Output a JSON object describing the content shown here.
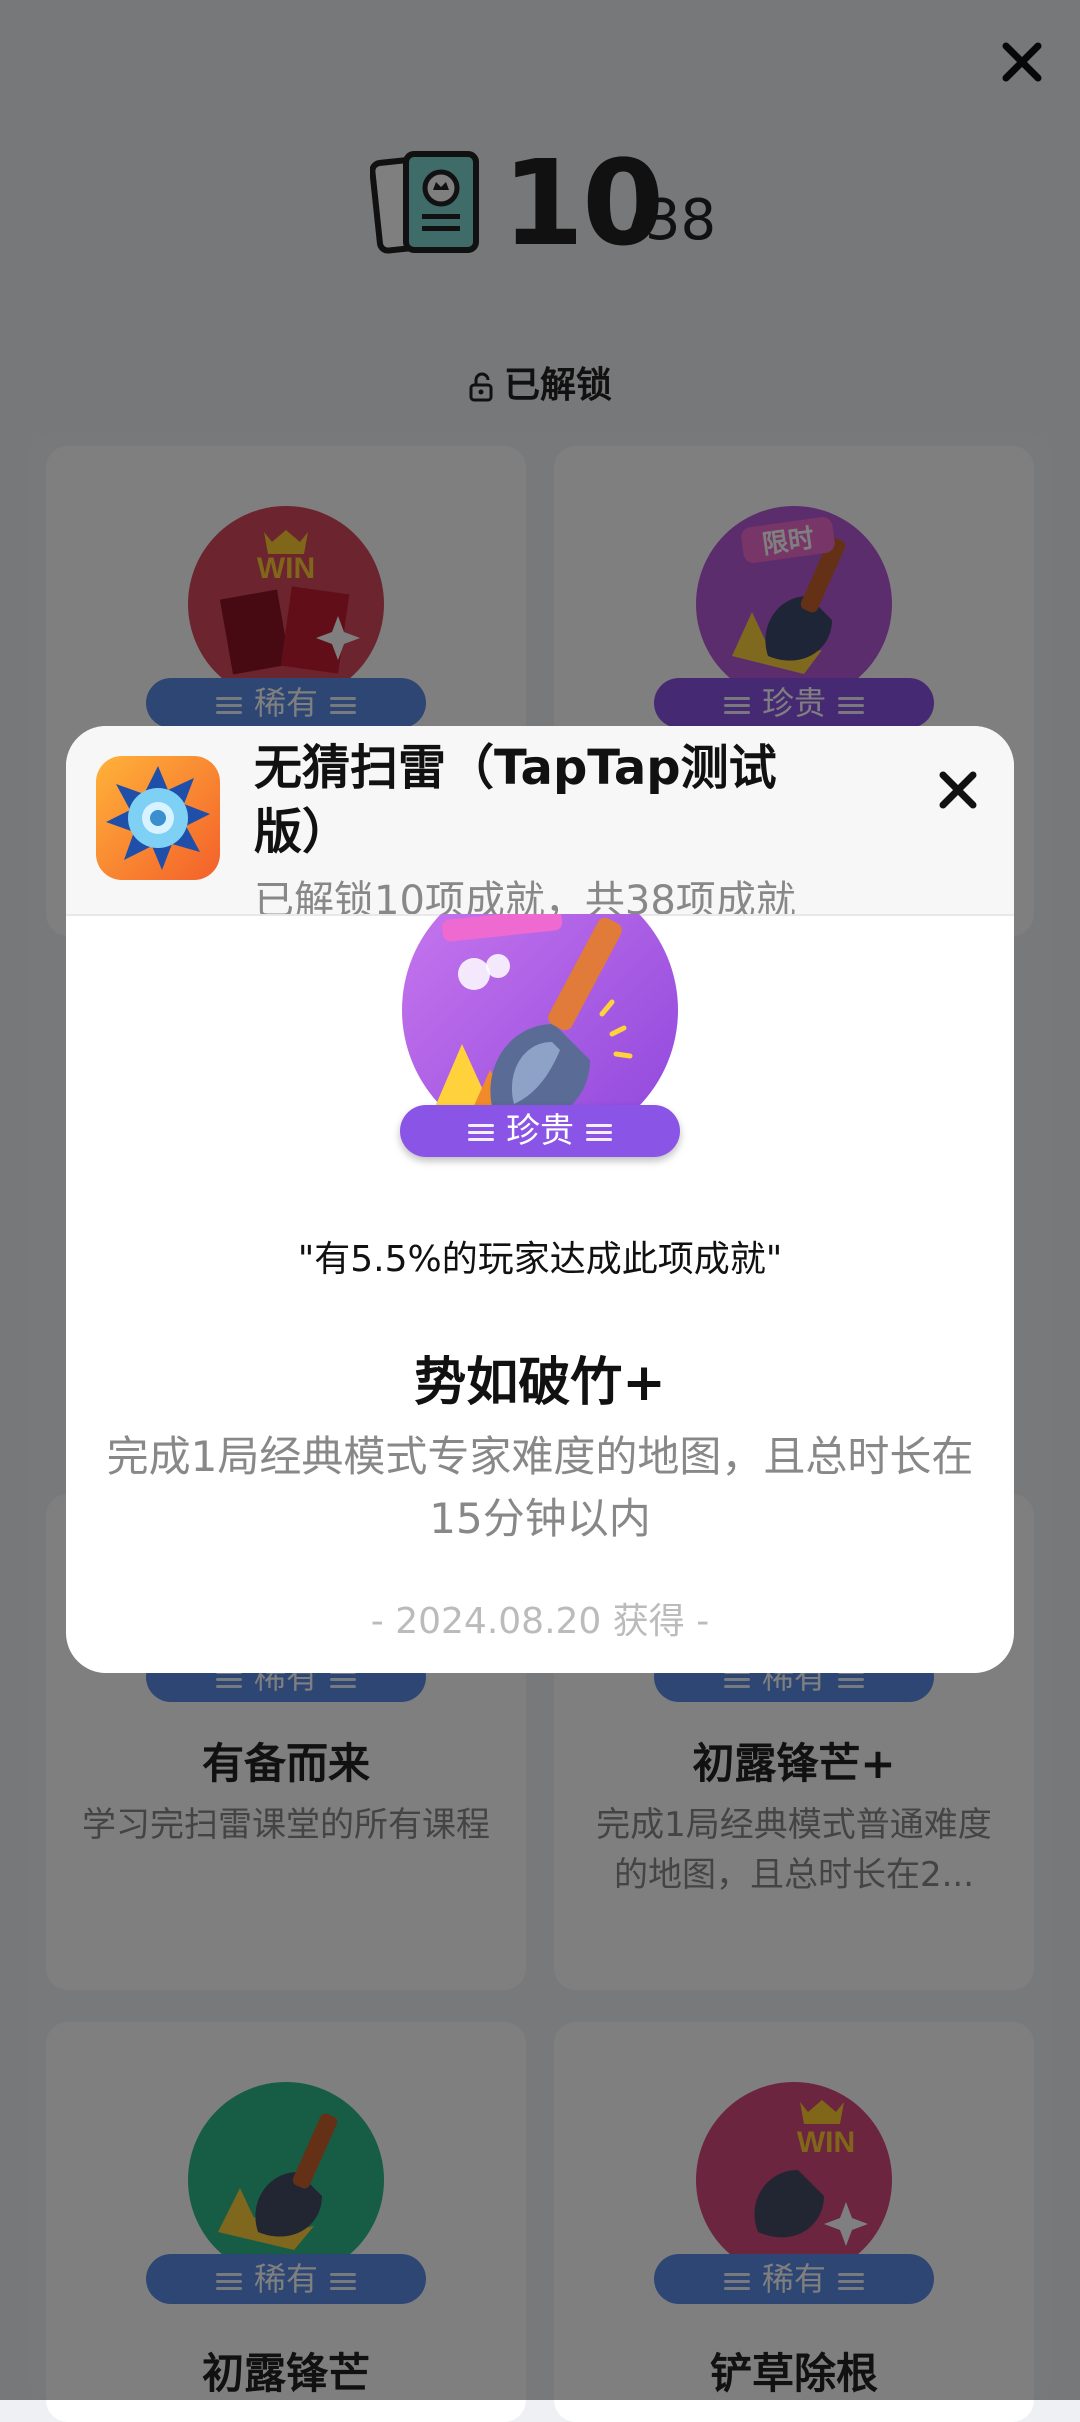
{
  "counter": {
    "unlocked": "10",
    "total": "/38"
  },
  "section_label": "已解锁",
  "cards": [
    {
      "badge": "稀有",
      "tier": "rare",
      "art_text": "WIN",
      "art": "win"
    },
    {
      "badge": "珍贵",
      "tier": "precious",
      "art_text": "限时",
      "art": "shovel-purple"
    },
    {
      "badge": "稀有",
      "tier": "rare",
      "title": "有备而来",
      "desc": "学习完扫雷课堂的所有课程"
    },
    {
      "badge": "稀有",
      "tier": "rare",
      "title": "初露锋芒+",
      "desc": "完成1局经典模式普通难度的地图，且总时长在2..."
    },
    {
      "badge": "稀有",
      "tier": "rare",
      "title": "初露锋芒",
      "art": "shovel-green"
    },
    {
      "badge": "稀有",
      "tier": "rare",
      "title": "铲草除根",
      "art_text": "WIN",
      "art": "win-shovel"
    }
  ],
  "modal": {
    "game_title": "无猜扫雷（TapTap测试版）",
    "game_subtitle": "已解锁10项成就，共38项成就",
    "badge": "珍贵",
    "quote": "\"有5.5%的玩家达成此项成就\"",
    "name": "势如破竹+",
    "description": "完成1局经典模式专家难度的地图，且总时长在15分钟以内",
    "date": "- 2024.08.20 获得 -"
  },
  "colors": {
    "rare": "#5a8ce8",
    "precious": "#8a55e6",
    "overlay": "rgba(0,0,0,0.5)"
  },
  "icons": [
    "close-icon",
    "certificate-icon",
    "unlock-icon",
    "mine-icon"
  ]
}
